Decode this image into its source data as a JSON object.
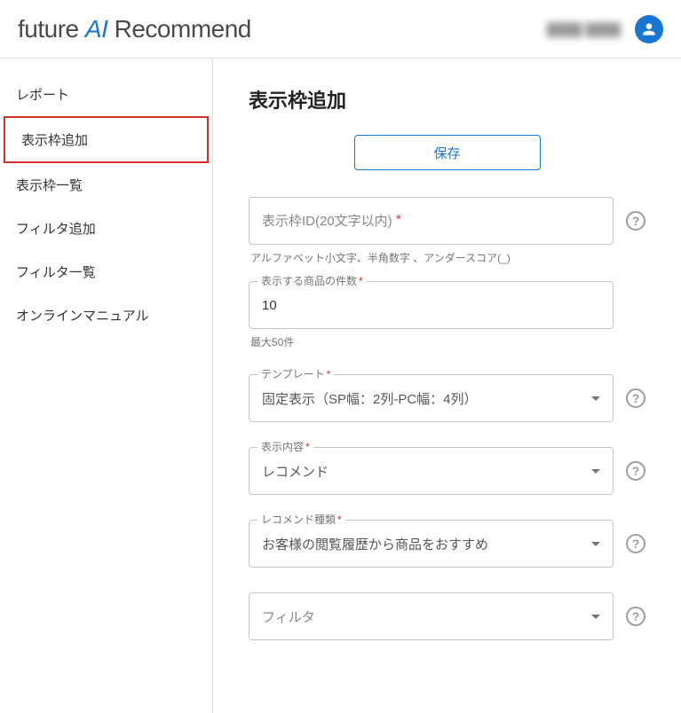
{
  "header": {
    "logo_prefix": "future ",
    "logo_ai": "AI",
    "logo_suffix": " Recommend",
    "user_name": "████ ████"
  },
  "sidebar": {
    "items": [
      {
        "label": "レポート",
        "active": false
      },
      {
        "label": "表示枠追加",
        "active": true
      },
      {
        "label": "表示枠一覧",
        "active": false
      },
      {
        "label": "フィルタ追加",
        "active": false
      },
      {
        "label": "フィルタ一覧",
        "active": false
      },
      {
        "label": "オンラインマニュアル",
        "active": false
      }
    ]
  },
  "main": {
    "title": "表示枠追加",
    "save_label": "保存"
  },
  "form": {
    "frame_id": {
      "placeholder": "表示枠ID(20文字以内)",
      "required": "*",
      "helper": "アルファベット小文字、半角数字 、アンダースコア(_)"
    },
    "item_count": {
      "label": "表示する商品の件数",
      "required": "*",
      "value": "10",
      "helper": "最大50件"
    },
    "template": {
      "label": "テンプレート",
      "required": "*",
      "value": "固定表示（SP幅：2列-PC幅：4列）"
    },
    "display_content": {
      "label": "表示内容",
      "required": "*",
      "value": "レコメンド"
    },
    "recommend_type": {
      "label": "レコメンド種類",
      "required": "*",
      "value": "お客様の閲覧履歴から商品をおすすめ"
    },
    "filter": {
      "placeholder": "フィルタ"
    }
  }
}
